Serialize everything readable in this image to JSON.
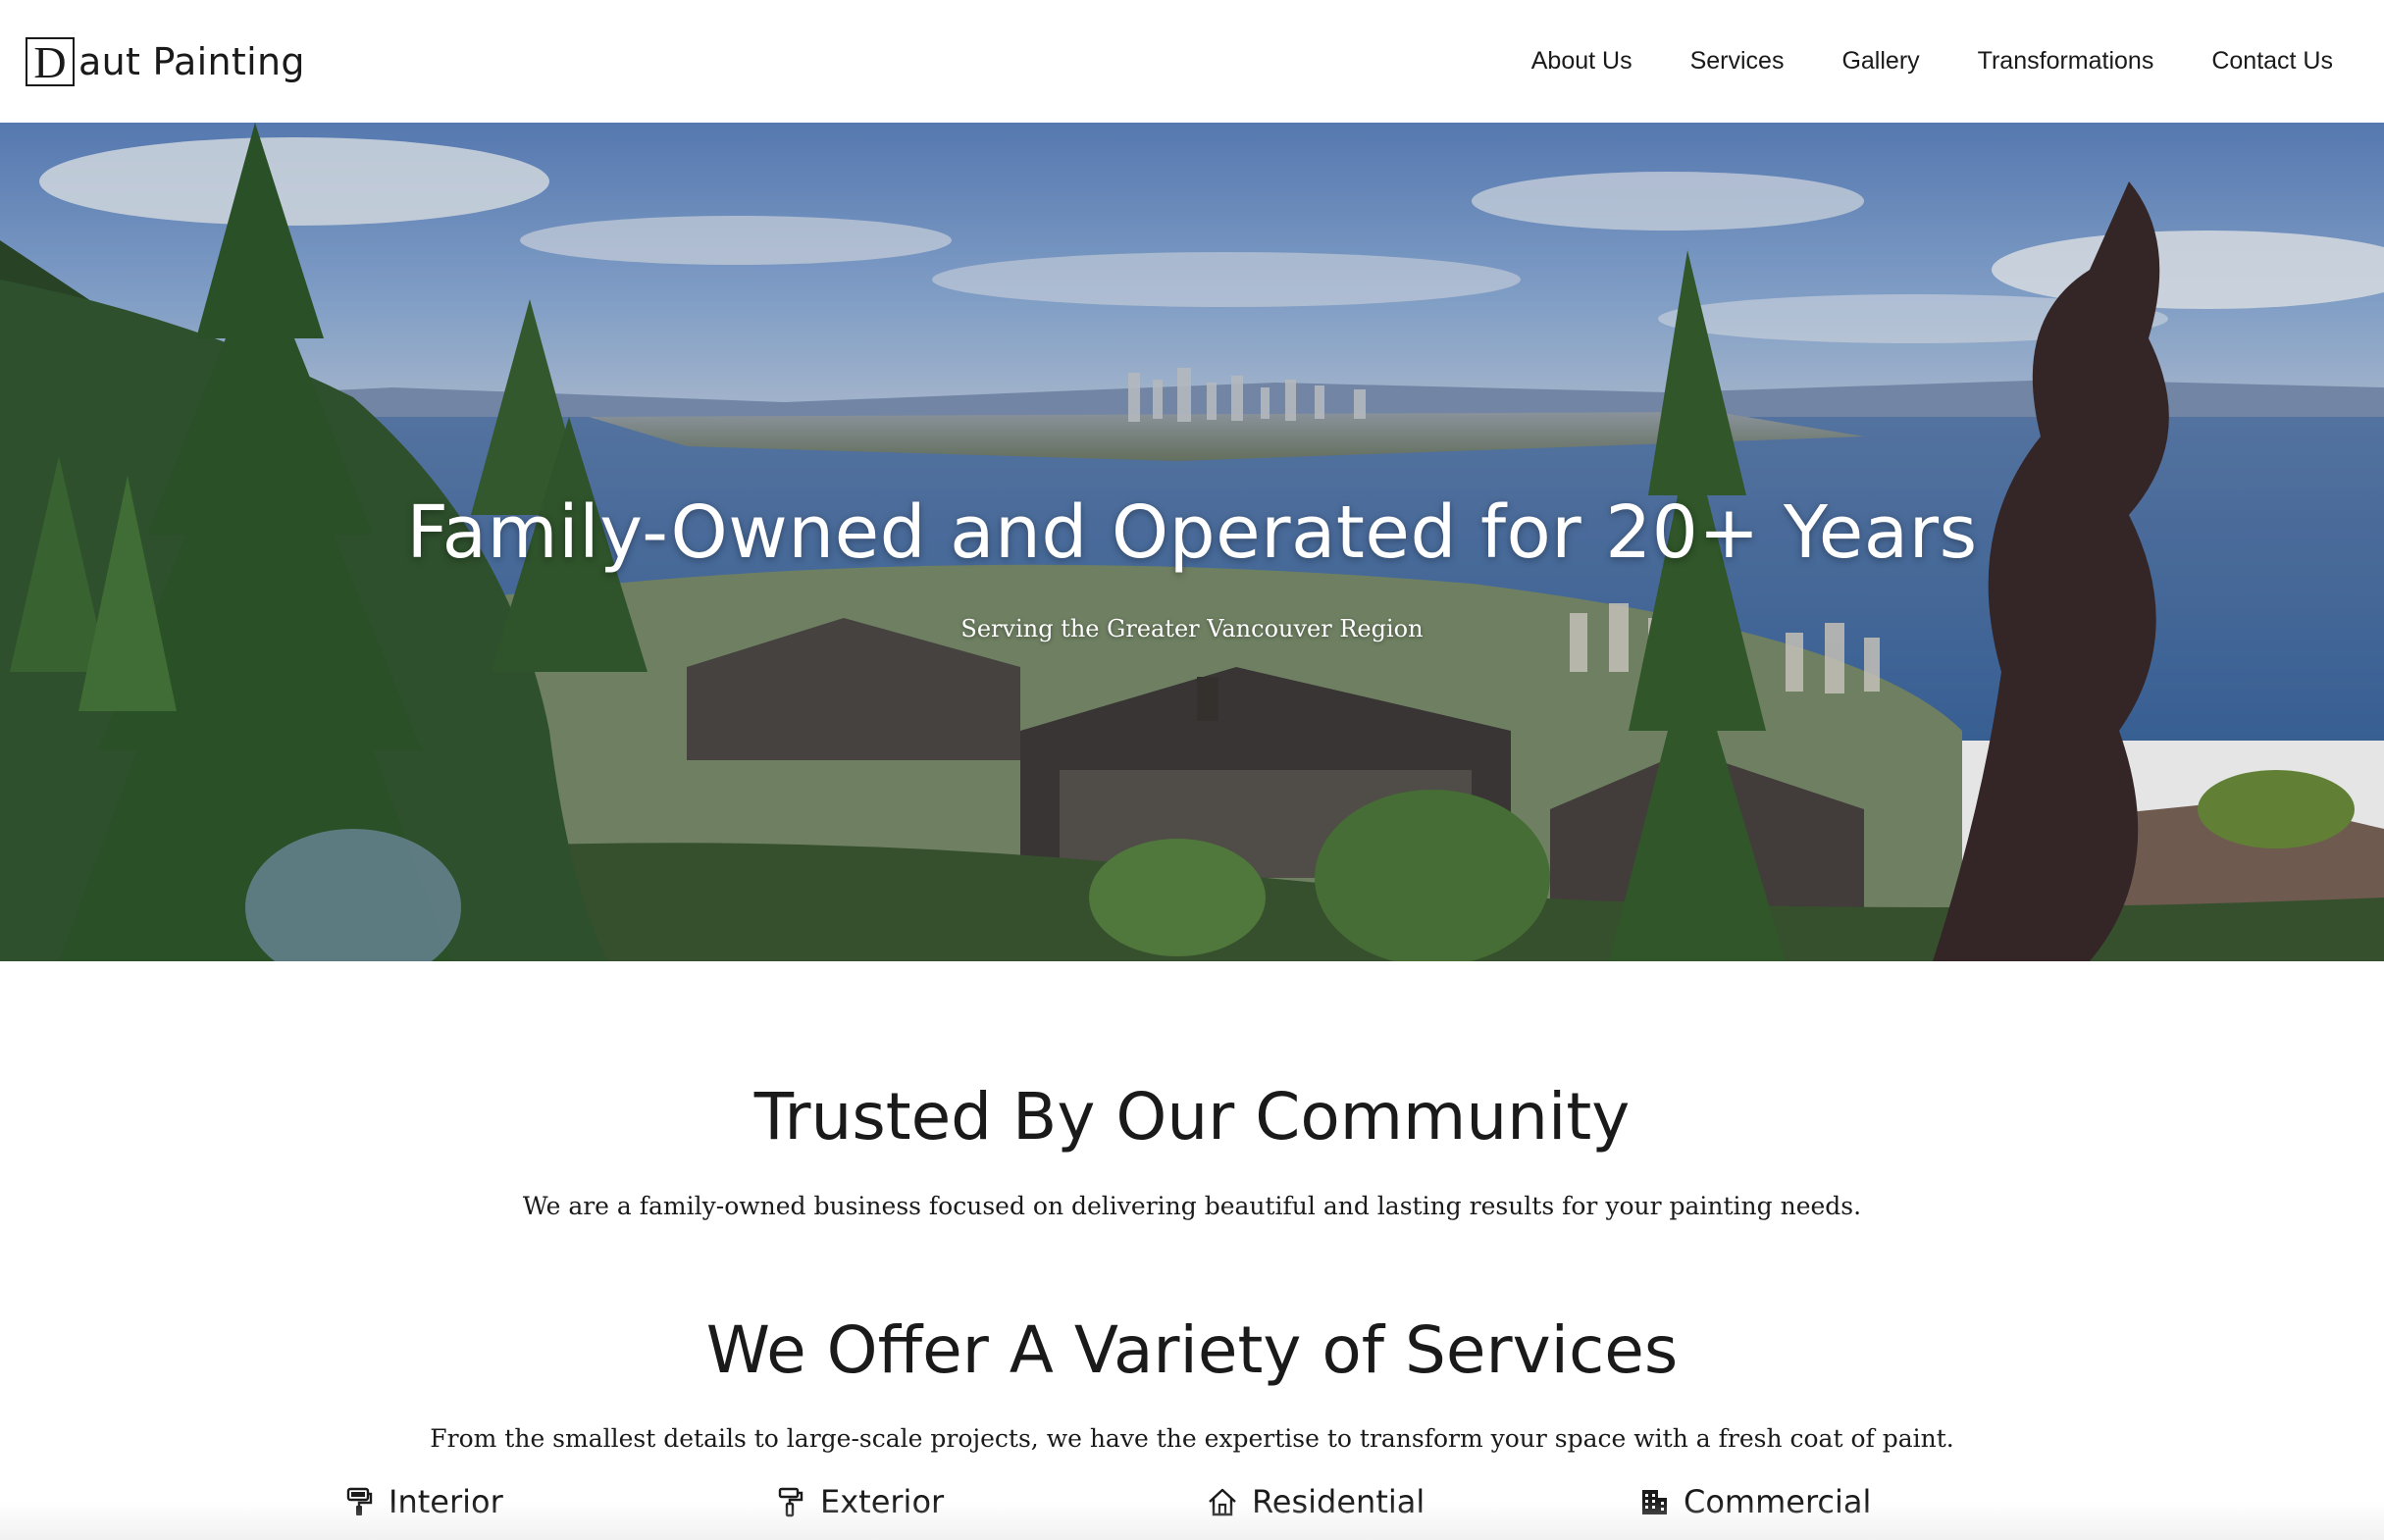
{
  "header": {
    "logo_letter": "D",
    "logo_rest": "aut Painting",
    "nav": [
      {
        "label": "About Us"
      },
      {
        "label": "Services"
      },
      {
        "label": "Gallery"
      },
      {
        "label": "Transformations"
      },
      {
        "label": "Contact Us"
      }
    ]
  },
  "hero": {
    "title": "Family-Owned and Operated for 20+ Years",
    "subtitle": "Serving the Greater Vancouver Region"
  },
  "trusted": {
    "title": "Trusted By Our Community",
    "text": "We are a family-owned business focused on delivering beautiful and lasting results for your painting needs."
  },
  "services": {
    "title": "We Offer A Variety of Services",
    "text": "From the smallest details to large-scale projects, we have the expertise to transform your space with a fresh coat of paint.",
    "items": [
      {
        "label": "Interior",
        "icon": "paint-roller-icon"
      },
      {
        "label": "Exterior",
        "icon": "paint-brush-icon"
      },
      {
        "label": "Residential",
        "icon": "house-icon"
      },
      {
        "label": "Commercial",
        "icon": "building-icon"
      }
    ]
  }
}
